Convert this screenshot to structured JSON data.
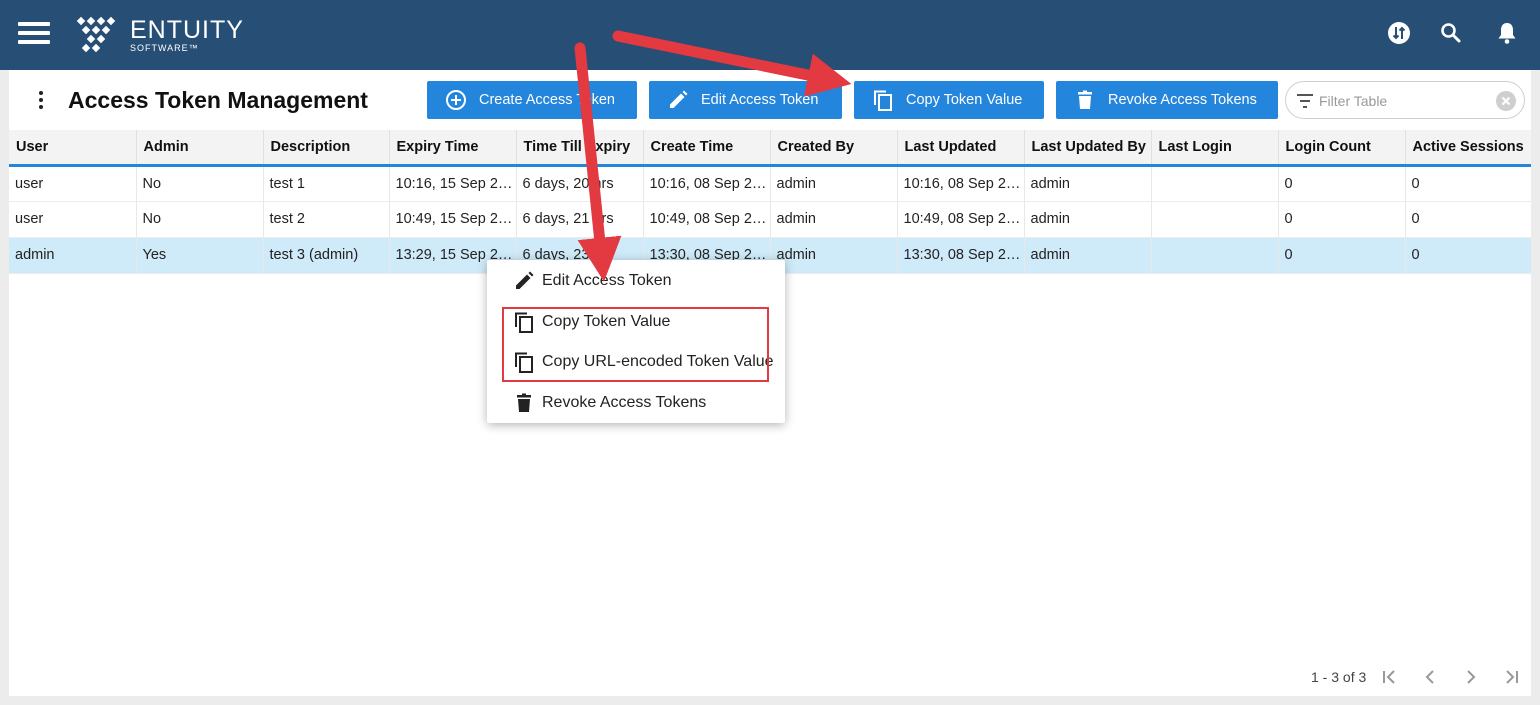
{
  "brand": {
    "name": "ENTUITY",
    "sub": "SOFTWARE™"
  },
  "topbar": {
    "icons": [
      "menu-icon",
      "sync-icon",
      "search-icon",
      "bell-icon"
    ]
  },
  "page": {
    "title": "Access Token Management"
  },
  "toolbar": {
    "create": "Create Access Token",
    "edit": "Edit Access Token",
    "copy": "Copy Token Value",
    "revoke": "Revoke Access Tokens"
  },
  "filter": {
    "placeholder": "Filter Table",
    "value": ""
  },
  "table": {
    "columns": [
      "User",
      "Admin",
      "Description",
      "Expiry Time",
      "Time Till Expiry",
      "Create Time",
      "Created By",
      "Last Updated",
      "Last Updated By",
      "Last Login",
      "Login Count",
      "Active Sessions"
    ],
    "rows": [
      [
        "user",
        "No",
        "test 1",
        "10:16, 15 Sep 2…",
        "6 days, 20 hrs",
        "10:16, 08 Sep 2…",
        "admin",
        "10:16, 08 Sep 2…",
        "admin",
        "",
        "0",
        "0"
      ],
      [
        "user",
        "No",
        "test 2",
        "10:49, 15 Sep 2…",
        "6 days, 21 hrs",
        "10:49, 08 Sep 2…",
        "admin",
        "10:49, 08 Sep 2…",
        "admin",
        "",
        "0",
        "0"
      ],
      [
        "admin",
        "Yes",
        "test 3 (admin)",
        "13:29, 15 Sep 2…",
        "6 days, 23 hrs",
        "13:30, 08 Sep 2…",
        "admin",
        "13:30, 08 Sep 2…",
        "admin",
        "",
        "0",
        "0"
      ]
    ],
    "selected_row": 3
  },
  "pager": {
    "range": "1 - 3 of 3"
  },
  "context_menu": {
    "items": [
      "Edit Access Token",
      "Copy Token Value",
      "Copy URL-encoded Token Value",
      "Revoke Access Tokens"
    ]
  },
  "colors": {
    "topbar": "#274e74",
    "accent": "#2385dc",
    "selected_row": "#cfeaf9",
    "annotation": "#e23a40"
  }
}
